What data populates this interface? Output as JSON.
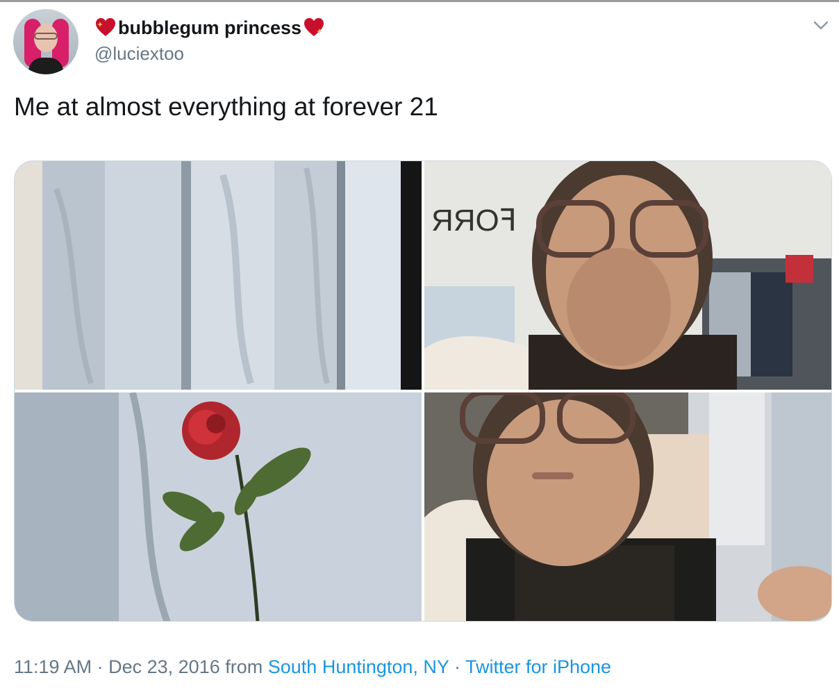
{
  "tweet": {
    "display_name": "bubblegum princess",
    "handle": "@luciextoo",
    "text": "Me at almost everything at forever 21",
    "time": "11:19 AM",
    "date": "Dec 23, 2016",
    "from_label": "from",
    "location": "South Huntington, NY",
    "client": "Twitter for iPhone",
    "separator": "·"
  },
  "icons": {
    "name_prefix": "sparkling-heart-icon",
    "name_suffix": "sparkling-heart-icon",
    "menu": "chevron-down-icon"
  },
  "colors": {
    "name": "#14171a",
    "secondary": "#657786",
    "link": "#1b95e0",
    "heart": "#c8102e"
  }
}
